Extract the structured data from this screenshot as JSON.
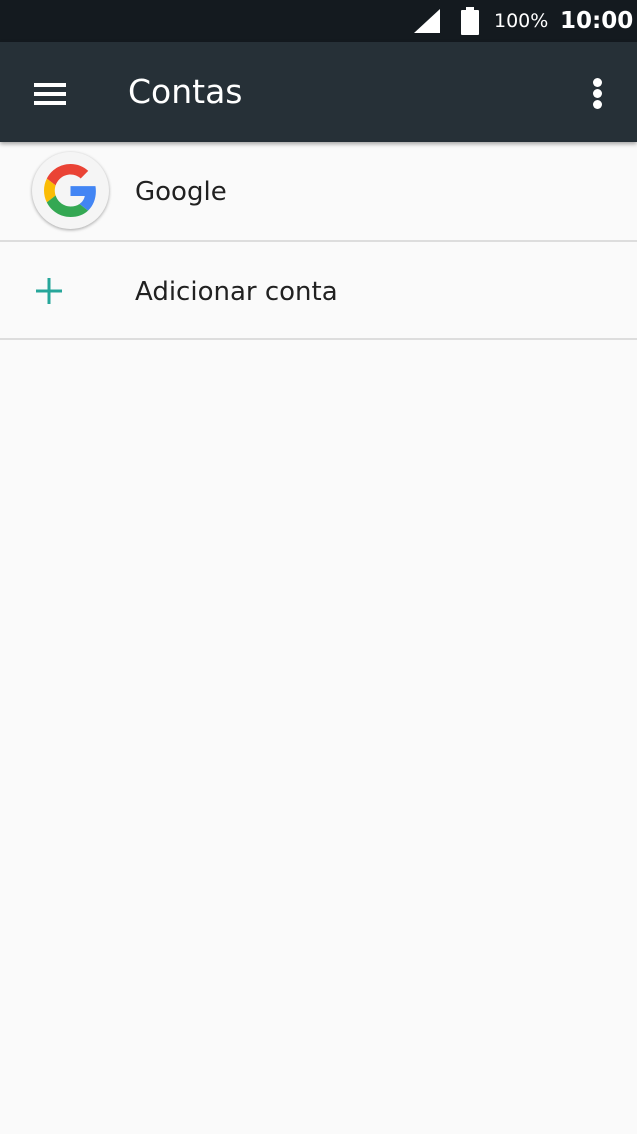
{
  "status_bar": {
    "battery": "100%",
    "time": "10:00",
    "icons": [
      "signal-icon",
      "battery-icon"
    ]
  },
  "app_bar": {
    "title": "Contas",
    "icons": [
      "menu-icon",
      "overflow-menu-icon"
    ]
  },
  "accounts": [
    {
      "label": "Google",
      "icon": "google-icon"
    },
    {
      "label": "Adicionar conta",
      "icon": "plus-icon"
    }
  ],
  "colors": {
    "status_bar": "#141a1f",
    "app_bar": "#263037",
    "background": "#fafafa",
    "accent": "#26a69a"
  }
}
